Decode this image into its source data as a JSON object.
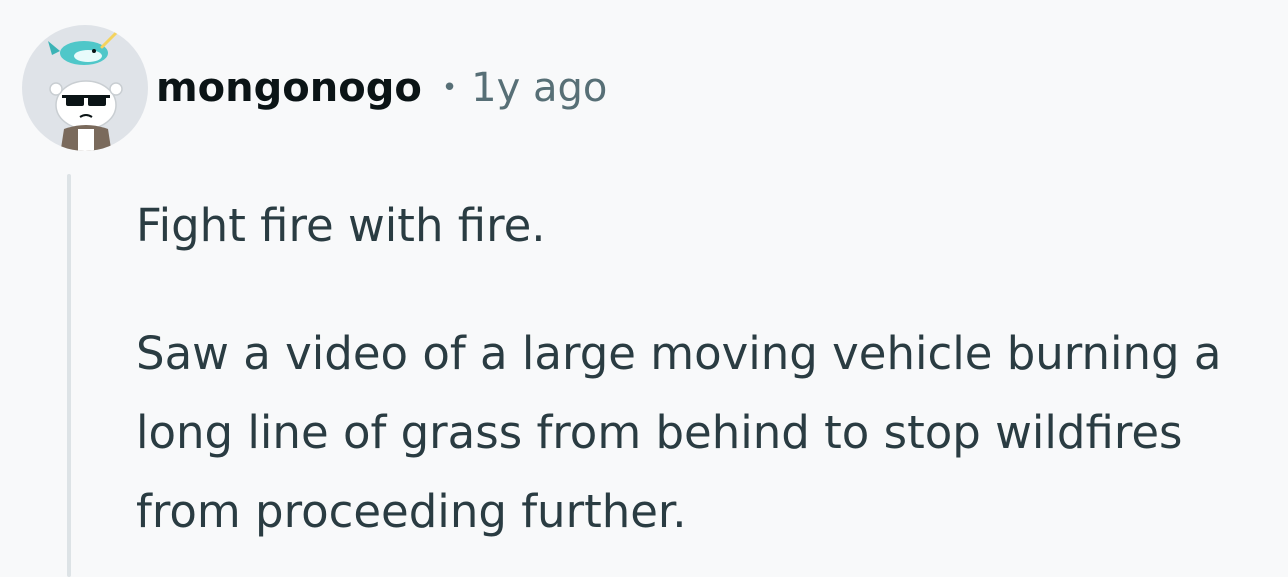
{
  "comment": {
    "author": "mongonogo",
    "separator": "•",
    "timestamp": "1y ago",
    "avatar_icon": "snoo-avatar-with-narwhal-hat-and-sunglasses",
    "paragraphs": [
      "Fight fire with fire.",
      "Saw a video of a large moving vehicle burning a long line of grass from behind to stop wildfires from proceeding further."
    ]
  },
  "colors": {
    "background": "#f8f9fa",
    "username": "#0b1416",
    "meta": "#576f76",
    "body_text": "#2a3c42",
    "thread_line": "#dde3e6"
  }
}
